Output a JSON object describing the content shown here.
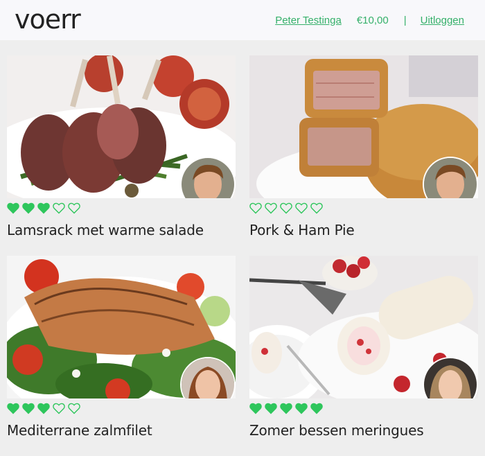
{
  "header": {
    "logo": "voerr",
    "user_name": "Peter Testinga",
    "balance": "€10,00",
    "separator": "|",
    "logout": "Uitloggen"
  },
  "colors": {
    "accent": "#35b06a",
    "heart": "#2ec65c"
  },
  "recipes": [
    {
      "title": "Lamsrack met warme salade",
      "rating": 3,
      "max_rating": 5
    },
    {
      "title": "Pork & Ham Pie",
      "rating": 0,
      "max_rating": 5
    },
    {
      "title": "Mediterrane zalmfilet",
      "rating": 3,
      "max_rating": 5
    },
    {
      "title": "Zomer bessen meringues",
      "rating": 5,
      "max_rating": 5
    }
  ]
}
